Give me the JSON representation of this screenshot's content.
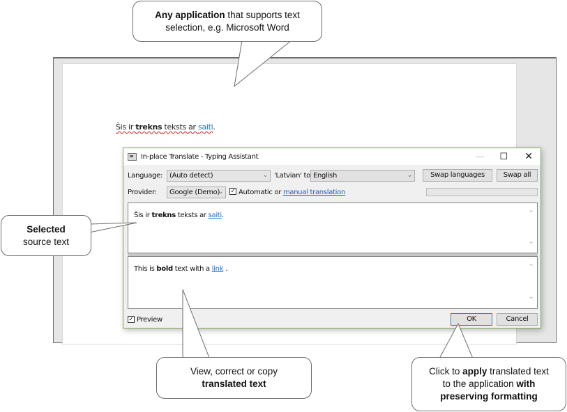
{
  "document": {
    "text_parts": {
      "p1": "Šis ir ",
      "bold": "trekns",
      "p2": " teksts ar ",
      "link": "saiti",
      "p3": "."
    }
  },
  "dialog": {
    "title": "In-place Translate - Typing Assistant",
    "window_controls": {
      "minimize": "—",
      "maximize": "☐",
      "close": "✕"
    },
    "language_label": "Language:",
    "source_language": "(Auto detect)",
    "detected_to_label": "'Latvian' to",
    "target_language": "English",
    "swap_languages_label": "Swap languages",
    "swap_all_label": "Swap all",
    "provider_label": "Provider:",
    "provider": "Google (Demo)",
    "automatic_checked": true,
    "automatic_label": "Automatic or ",
    "manual_link": "manual translation",
    "source_text": {
      "p1": "Šis ir ",
      "bold": "trekns",
      "p2": " teksts ar ",
      "link": "saiti",
      "p3": "."
    },
    "translated_text": {
      "p1": "This is ",
      "bold": "bold",
      "p2": " text with a ",
      "link": "link",
      "p3": " ."
    },
    "preview_checked": true,
    "preview_label": "Preview",
    "ok_label": "OK",
    "cancel_label": "Cancel"
  },
  "callouts": {
    "top": {
      "bold": "Any application",
      "rest1": " that supports text",
      "line2": "selection, e.g. Microsoft Word"
    },
    "left": {
      "bold": "Selected",
      "line2": "source text"
    },
    "bottom_middle": {
      "line1": "View, correct or copy",
      "bold": "translated text"
    },
    "bottom_right": {
      "l1a": "Click to ",
      "l1b": "apply",
      "l1c": " translated text",
      "l2a": "to the application ",
      "l2b": "with",
      "l3": "preserving formatting"
    }
  }
}
